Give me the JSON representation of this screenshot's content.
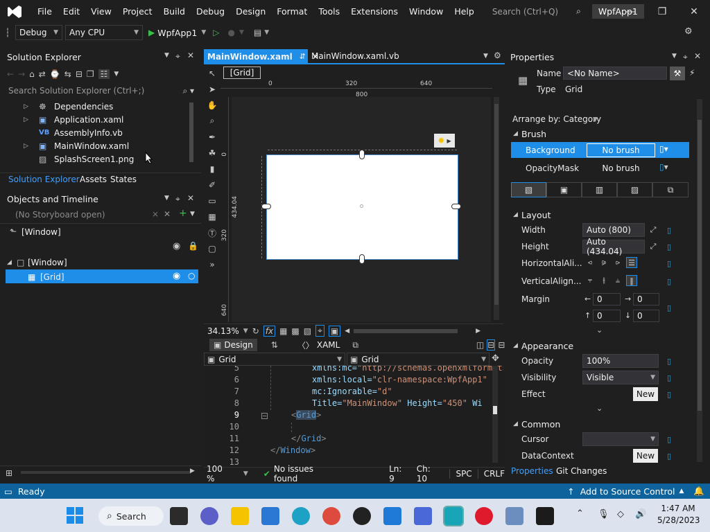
{
  "menu": [
    "File",
    "Edit",
    "View",
    "Project",
    "Build",
    "Debug",
    "Design",
    "Format",
    "Tools",
    "Extensions",
    "Window",
    "Help"
  ],
  "search_placeholder": "Search (Ctrl+Q)",
  "app_name": "WpfApp1",
  "toolbar": {
    "config": "Debug",
    "platform": "Any CPU",
    "start_target": "WpfApp1"
  },
  "solution_explorer": {
    "title": "Solution Explorer",
    "search_placeholder": "Search Solution Explorer (Ctrl+;)",
    "items": [
      "Dependencies",
      "Application.xaml",
      "AssemblyInfo.vb",
      "MainWindow.xaml",
      "SplashScreen1.png"
    ],
    "tabs": [
      "Solution Explorer",
      "Assets",
      "States"
    ]
  },
  "objects_timeline": {
    "title": "Objects and Timeline",
    "storyboard": "(No Storyboard open)",
    "root": "[Window]",
    "tree": [
      "[Window]",
      "[Grid]"
    ]
  },
  "doc_tabs": [
    "MainWindow.xaml",
    "MainWindow.xaml.vb"
  ],
  "designer": {
    "breadcrumb": "[Grid]",
    "ruler_top": [
      "0",
      "320",
      "640"
    ],
    "ruler_width": "800",
    "ruler_left": [
      "0",
      "320",
      "640"
    ],
    "ruler_height": "434.04",
    "zoom": "34.13%"
  },
  "split_tabs": {
    "design": "Design",
    "xaml": "XAML"
  },
  "scope": {
    "left": "Grid",
    "right": "Grid"
  },
  "code": {
    "line_numbers": [
      "5",
      "6",
      "7",
      "8",
      "9",
      "10",
      "11",
      "12",
      "13"
    ],
    "l5_attr": "xmlns:mc=",
    "l5_val": "\"http://schemas.openxmlformats\"",
    "l6_attr": "xmlns:local=",
    "l6_val": "\"clr-namespace:WpfApp1\"",
    "l7_attr": "mc:Ignorable=",
    "l7_val": "\"d\"",
    "l8_attr1": "Title=",
    "l8_val1": "\"MainWindow\"",
    "l8_attr2": " Height=",
    "l8_val2": "\"450\"",
    "l8_attr3": " Wi",
    "l9_tag": "Grid",
    "l11_tag": "Grid",
    "l12_tag": "Window"
  },
  "editor_status": {
    "zoom": "100 %",
    "issues": "No issues found",
    "line": "Ln: 9",
    "col": "Ch: 10",
    "mode": "SPC",
    "eol": "CRLF"
  },
  "properties": {
    "title": "Properties",
    "name_label": "Name",
    "name_value": "<No Name>",
    "type_label": "Type",
    "type_value": "Grid",
    "arrange": "Arrange by: Category",
    "brush": {
      "header": "Brush",
      "background_label": "Background",
      "background_value": "No brush",
      "opacity_mask_label": "OpacityMask",
      "opacity_mask_value": "No brush"
    },
    "layout": {
      "header": "Layout",
      "width_label": "Width",
      "width_value": "Auto (800)",
      "height_label": "Height",
      "height_value": "Auto (434.04)",
      "halign_label": "HorizontalAli...",
      "valign_label": "VerticalAlign...",
      "margin_label": "Margin",
      "margin": [
        "0",
        "0",
        "0",
        "0"
      ]
    },
    "appearance": {
      "header": "Appearance",
      "opacity_label": "Opacity",
      "opacity_value": "100%",
      "visibility_label": "Visibility",
      "visibility_value": "Visible",
      "effect_label": "Effect",
      "new_label": "New"
    },
    "common": {
      "header": "Common",
      "cursor_label": "Cursor",
      "datacontext_label": "DataContext",
      "new_label": "New"
    },
    "tabs": [
      "Properties",
      "Git Changes"
    ]
  },
  "status": {
    "ready": "Ready",
    "source_control": "Add to Source Control"
  },
  "taskbar": {
    "search": "Search",
    "time": "1:47 AM",
    "date": "5/28/2023"
  },
  "colors": {
    "accent": "#0e639c",
    "selection": "#1e8ee8",
    "background": "#1f1f1f"
  }
}
